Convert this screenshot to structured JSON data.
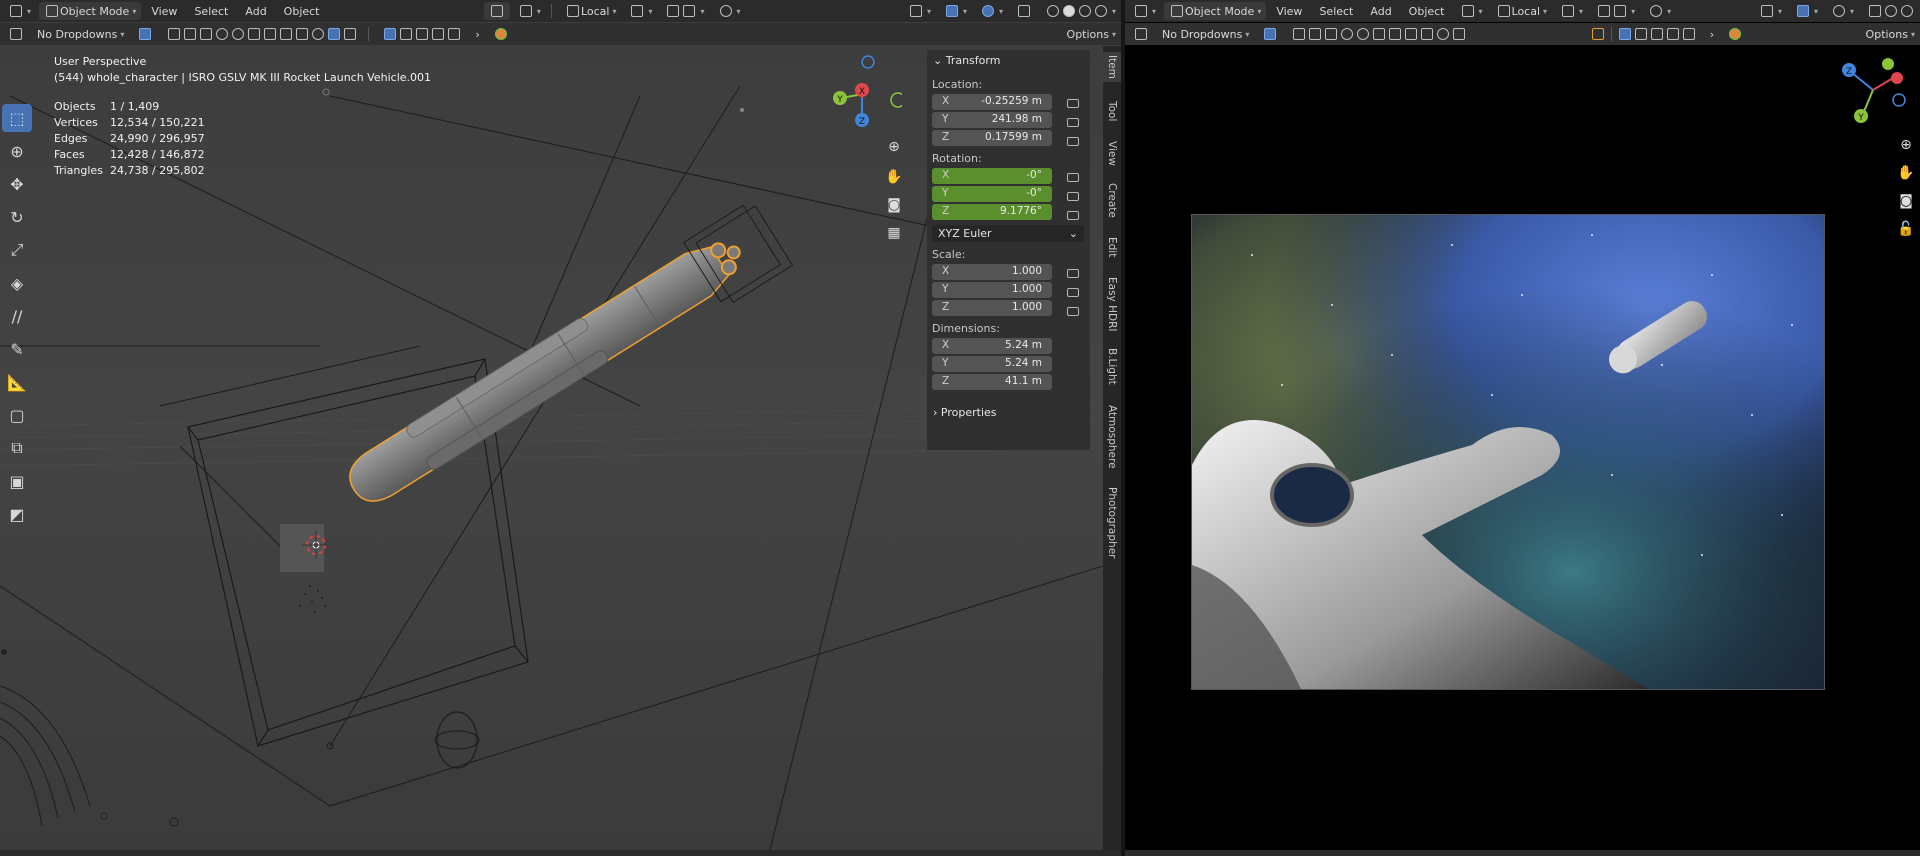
{
  "left_header": {
    "mode": "Object Mode",
    "menus": [
      "View",
      "Select",
      "Add",
      "Object"
    ],
    "orientation": "Local",
    "dropdowns_label": "No Dropdowns",
    "options_label": "Options"
  },
  "right_header": {
    "mode": "Object Mode",
    "menus": [
      "View",
      "Select",
      "Add",
      "Object"
    ],
    "orientation": "Local",
    "dropdowns_label": "No Dropdowns",
    "options_label": "Options"
  },
  "viewport": {
    "perspective": "User Perspective",
    "object_info": "(544) whole_character | ISRO GSLV MK III Rocket Launch Vehicle.001",
    "stats": [
      {
        "label": "Objects",
        "value": "1 / 1,409"
      },
      {
        "label": "Vertices",
        "value": "12,534 / 150,221"
      },
      {
        "label": "Edges",
        "value": "24,990 / 296,957"
      },
      {
        "label": "Faces",
        "value": "12,428 / 146,872"
      },
      {
        "label": "Triangles",
        "value": "24,738 / 295,802"
      }
    ],
    "gizmo_labels": {
      "x": "X",
      "y": "Y",
      "z": "Z"
    }
  },
  "npanel": {
    "transform_title": "Transform",
    "location_label": "Location:",
    "location": [
      {
        "axis": "X",
        "value": "-0.25259 m"
      },
      {
        "axis": "Y",
        "value": "241.98 m"
      },
      {
        "axis": "Z",
        "value": "0.17599 m"
      }
    ],
    "rotation_label": "Rotation:",
    "rotation": [
      {
        "axis": "X",
        "value": "-0°"
      },
      {
        "axis": "Y",
        "value": "-0°"
      },
      {
        "axis": "Z",
        "value": "9.1776°"
      }
    ],
    "rotation_mode": "XYZ Euler",
    "scale_label": "Scale:",
    "scale": [
      {
        "axis": "X",
        "value": "1.000"
      },
      {
        "axis": "Y",
        "value": "1.000"
      },
      {
        "axis": "Z",
        "value": "1.000"
      }
    ],
    "dimensions_label": "Dimensions:",
    "dimensions": [
      {
        "axis": "X",
        "value": "5.24 m"
      },
      {
        "axis": "Y",
        "value": "5.24 m"
      },
      {
        "axis": "Z",
        "value": "41.1 m"
      }
    ],
    "properties_title": "Properties"
  },
  "side_tabs": [
    "Item",
    "Tool",
    "View",
    "Create",
    "Edit",
    "Easy HDRI",
    "B.Light",
    "Atmosphere",
    "Photographer"
  ],
  "colors": {
    "accent": "#4772b3",
    "animated_field": "#5b8e2d",
    "selection_outline": "#f0a030",
    "axis_x": "#e0464e",
    "axis_y": "#8bc43a",
    "axis_z": "#3f86e0"
  },
  "icons": {
    "toolbar": [
      "select-box-icon",
      "cursor-icon",
      "move-icon",
      "rotate-icon",
      "scale-icon",
      "transform-icon",
      "annotate-icon",
      "draw-icon",
      "measure-icon",
      "add-cube-icon",
      "extrude-icon",
      "image-icon",
      "curve-icon"
    ],
    "nav": [
      "zoom-icon",
      "hand-pan-icon",
      "camera-icon",
      "grid-ortho-icon"
    ]
  }
}
